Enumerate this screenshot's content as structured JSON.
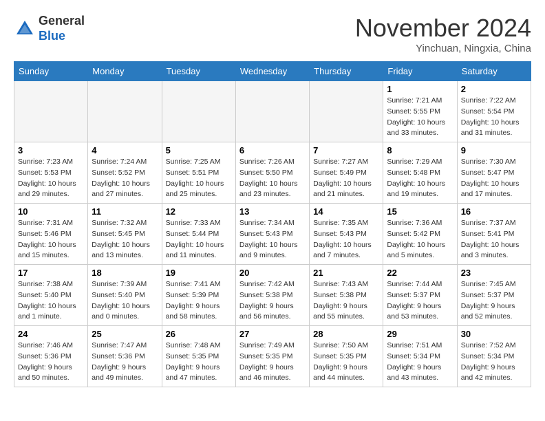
{
  "header": {
    "logo_line1": "General",
    "logo_line2": "Blue",
    "month": "November 2024",
    "location": "Yinchuan, Ningxia, China"
  },
  "weekdays": [
    "Sunday",
    "Monday",
    "Tuesday",
    "Wednesday",
    "Thursday",
    "Friday",
    "Saturday"
  ],
  "weeks": [
    [
      {
        "day": "",
        "info": ""
      },
      {
        "day": "",
        "info": ""
      },
      {
        "day": "",
        "info": ""
      },
      {
        "day": "",
        "info": ""
      },
      {
        "day": "",
        "info": ""
      },
      {
        "day": "1",
        "info": "Sunrise: 7:21 AM\nSunset: 5:55 PM\nDaylight: 10 hours and 33 minutes."
      },
      {
        "day": "2",
        "info": "Sunrise: 7:22 AM\nSunset: 5:54 PM\nDaylight: 10 hours and 31 minutes."
      }
    ],
    [
      {
        "day": "3",
        "info": "Sunrise: 7:23 AM\nSunset: 5:53 PM\nDaylight: 10 hours and 29 minutes."
      },
      {
        "day": "4",
        "info": "Sunrise: 7:24 AM\nSunset: 5:52 PM\nDaylight: 10 hours and 27 minutes."
      },
      {
        "day": "5",
        "info": "Sunrise: 7:25 AM\nSunset: 5:51 PM\nDaylight: 10 hours and 25 minutes."
      },
      {
        "day": "6",
        "info": "Sunrise: 7:26 AM\nSunset: 5:50 PM\nDaylight: 10 hours and 23 minutes."
      },
      {
        "day": "7",
        "info": "Sunrise: 7:27 AM\nSunset: 5:49 PM\nDaylight: 10 hours and 21 minutes."
      },
      {
        "day": "8",
        "info": "Sunrise: 7:29 AM\nSunset: 5:48 PM\nDaylight: 10 hours and 19 minutes."
      },
      {
        "day": "9",
        "info": "Sunrise: 7:30 AM\nSunset: 5:47 PM\nDaylight: 10 hours and 17 minutes."
      }
    ],
    [
      {
        "day": "10",
        "info": "Sunrise: 7:31 AM\nSunset: 5:46 PM\nDaylight: 10 hours and 15 minutes."
      },
      {
        "day": "11",
        "info": "Sunrise: 7:32 AM\nSunset: 5:45 PM\nDaylight: 10 hours and 13 minutes."
      },
      {
        "day": "12",
        "info": "Sunrise: 7:33 AM\nSunset: 5:44 PM\nDaylight: 10 hours and 11 minutes."
      },
      {
        "day": "13",
        "info": "Sunrise: 7:34 AM\nSunset: 5:43 PM\nDaylight: 10 hours and 9 minutes."
      },
      {
        "day": "14",
        "info": "Sunrise: 7:35 AM\nSunset: 5:43 PM\nDaylight: 10 hours and 7 minutes."
      },
      {
        "day": "15",
        "info": "Sunrise: 7:36 AM\nSunset: 5:42 PM\nDaylight: 10 hours and 5 minutes."
      },
      {
        "day": "16",
        "info": "Sunrise: 7:37 AM\nSunset: 5:41 PM\nDaylight: 10 hours and 3 minutes."
      }
    ],
    [
      {
        "day": "17",
        "info": "Sunrise: 7:38 AM\nSunset: 5:40 PM\nDaylight: 10 hours and 1 minute."
      },
      {
        "day": "18",
        "info": "Sunrise: 7:39 AM\nSunset: 5:40 PM\nDaylight: 10 hours and 0 minutes."
      },
      {
        "day": "19",
        "info": "Sunrise: 7:41 AM\nSunset: 5:39 PM\nDaylight: 9 hours and 58 minutes."
      },
      {
        "day": "20",
        "info": "Sunrise: 7:42 AM\nSunset: 5:38 PM\nDaylight: 9 hours and 56 minutes."
      },
      {
        "day": "21",
        "info": "Sunrise: 7:43 AM\nSunset: 5:38 PM\nDaylight: 9 hours and 55 minutes."
      },
      {
        "day": "22",
        "info": "Sunrise: 7:44 AM\nSunset: 5:37 PM\nDaylight: 9 hours and 53 minutes."
      },
      {
        "day": "23",
        "info": "Sunrise: 7:45 AM\nSunset: 5:37 PM\nDaylight: 9 hours and 52 minutes."
      }
    ],
    [
      {
        "day": "24",
        "info": "Sunrise: 7:46 AM\nSunset: 5:36 PM\nDaylight: 9 hours and 50 minutes."
      },
      {
        "day": "25",
        "info": "Sunrise: 7:47 AM\nSunset: 5:36 PM\nDaylight: 9 hours and 49 minutes."
      },
      {
        "day": "26",
        "info": "Sunrise: 7:48 AM\nSunset: 5:35 PM\nDaylight: 9 hours and 47 minutes."
      },
      {
        "day": "27",
        "info": "Sunrise: 7:49 AM\nSunset: 5:35 PM\nDaylight: 9 hours and 46 minutes."
      },
      {
        "day": "28",
        "info": "Sunrise: 7:50 AM\nSunset: 5:35 PM\nDaylight: 9 hours and 44 minutes."
      },
      {
        "day": "29",
        "info": "Sunrise: 7:51 AM\nSunset: 5:34 PM\nDaylight: 9 hours and 43 minutes."
      },
      {
        "day": "30",
        "info": "Sunrise: 7:52 AM\nSunset: 5:34 PM\nDaylight: 9 hours and 42 minutes."
      }
    ]
  ]
}
